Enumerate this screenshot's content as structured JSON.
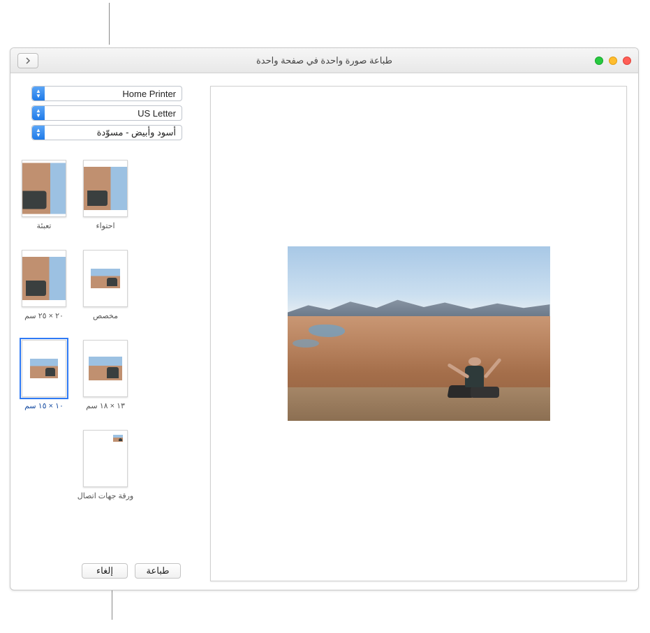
{
  "window": {
    "title": "طباعة صورة واحدة في صفحة واحدة"
  },
  "popups": {
    "printer": "Home Printer",
    "paper_size": "US Letter",
    "color_mode": "أسود وأبيض - مسوّدة"
  },
  "thumbnails": [
    {
      "id": "contain",
      "label": "احتواء",
      "selected": false,
      "style": "fit",
      "row": 0,
      "col": 0
    },
    {
      "id": "fill",
      "label": "تعبئة",
      "selected": false,
      "style": "fill",
      "row": 0,
      "col": 1
    },
    {
      "id": "custom",
      "label": "مخصص",
      "selected": false,
      "style": "small",
      "row": 1,
      "col": 0
    },
    {
      "id": "20x25",
      "label": "٢٠ × ٢٥ سم",
      "selected": false,
      "style": "fit",
      "row": 1,
      "col": 1
    },
    {
      "id": "13x18",
      "label": "١٣ × ١٨ سم",
      "selected": false,
      "style": "small",
      "row": 2,
      "col": 0
    },
    {
      "id": "10x15",
      "label": "١٠ × ١٥ سم",
      "selected": true,
      "style": "small",
      "row": 2,
      "col": 1
    },
    {
      "id": "contact",
      "label": "ورقة جهات اتصال",
      "selected": false,
      "style": "tiny",
      "row": 3,
      "col": 0
    }
  ],
  "buttons": {
    "cancel": "إلغاء",
    "print": "طباعة"
  }
}
